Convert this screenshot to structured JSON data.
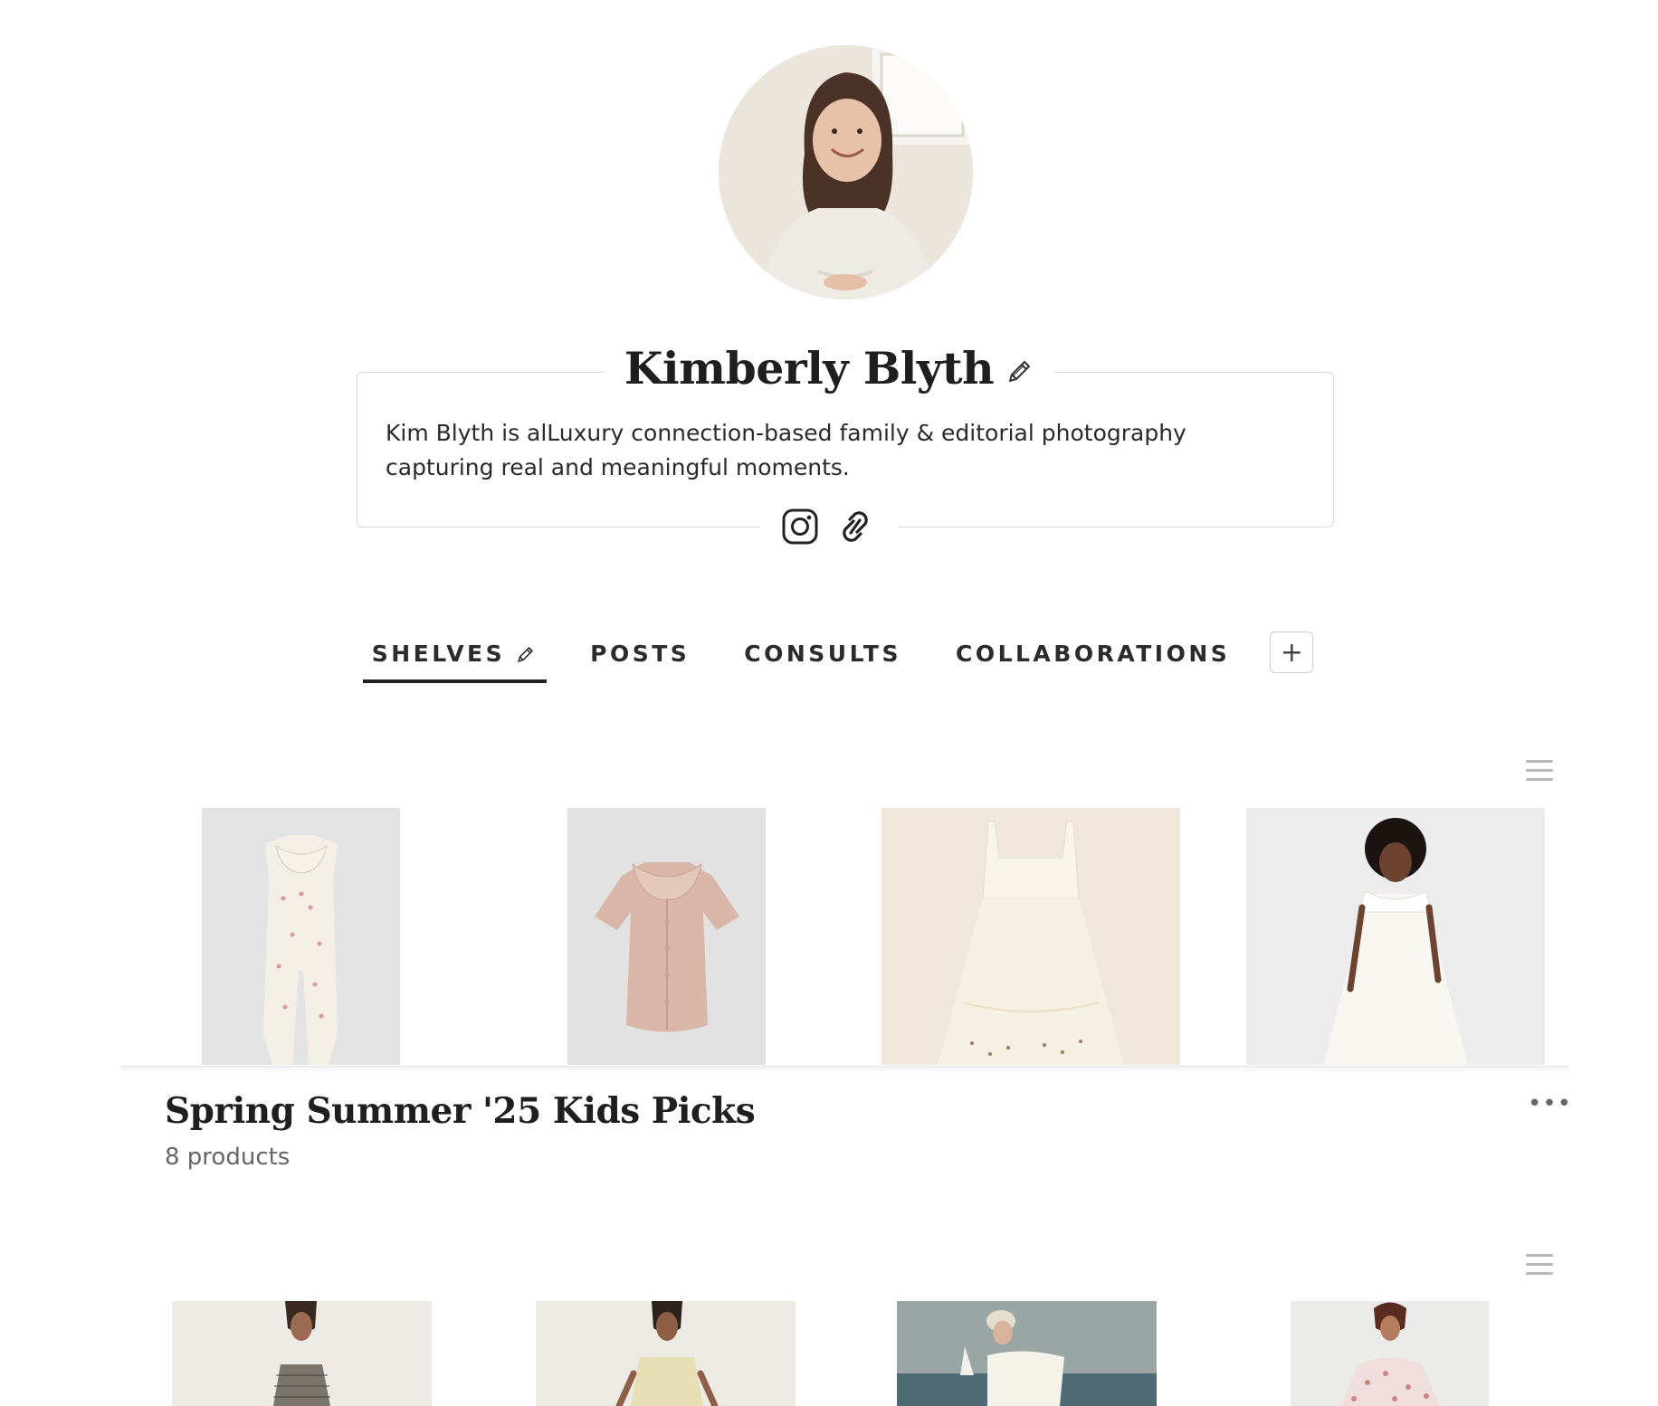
{
  "profile": {
    "name": "Kimberly Blyth",
    "bio": "Kim Blyth is alLuxury connection-based family & editorial photography capturing real and meaningful moments."
  },
  "social": {
    "icons": [
      "instagram-icon",
      "link-icon"
    ]
  },
  "tabs": [
    {
      "label": "SHELVES",
      "active": true
    },
    {
      "label": "POSTS",
      "active": false
    },
    {
      "label": "CONSULTS",
      "active": false
    },
    {
      "label": "COLLABORATIONS",
      "active": false
    }
  ],
  "add_tab_label": "+",
  "shelves": [
    {
      "title": "Spring Summer '25 Kids Picks",
      "count": "8 products"
    }
  ],
  "more_label": "•••",
  "colors": {
    "text": "#222222",
    "muted": "#666666",
    "border": "#d9d9d9",
    "active_tab_underline": "#222222"
  }
}
